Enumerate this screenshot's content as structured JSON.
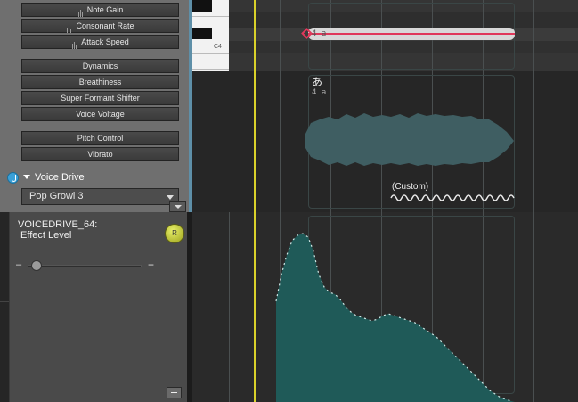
{
  "panel": {
    "buttons_group1": [
      "Note Gain",
      "Consonant Rate",
      "Attack Speed"
    ],
    "buttons_group2": [
      "Dynamics",
      "Breathiness",
      "Super Formant Shifter",
      "Voice Voltage"
    ],
    "buttons_group3": [
      "Pitch Control",
      "Vibrato"
    ],
    "voice_drive_label": "Voice Drive",
    "voice_drive_preset": "Pop Growl 3"
  },
  "parameter": {
    "label": "VOICEDRIVE_64:\n Effect Level",
    "knob_label": "R",
    "slider_minus": "–",
    "slider_plus": "+",
    "slider_value_fraction": 0.08
  },
  "piano": {
    "octave_label": "C4"
  },
  "note": {
    "lyric": "4 a",
    "phoneme": "あ",
    "phoneme_sub": "4 a"
  },
  "vibrato": {
    "label": "(Custom)"
  },
  "colors": {
    "accent_blue": "#3aa0d8",
    "note_red": "#e0375a",
    "playhead_yellow": "#d9d12a",
    "waveform": "#3f5e62",
    "curve_fill": "#1f5a58"
  }
}
